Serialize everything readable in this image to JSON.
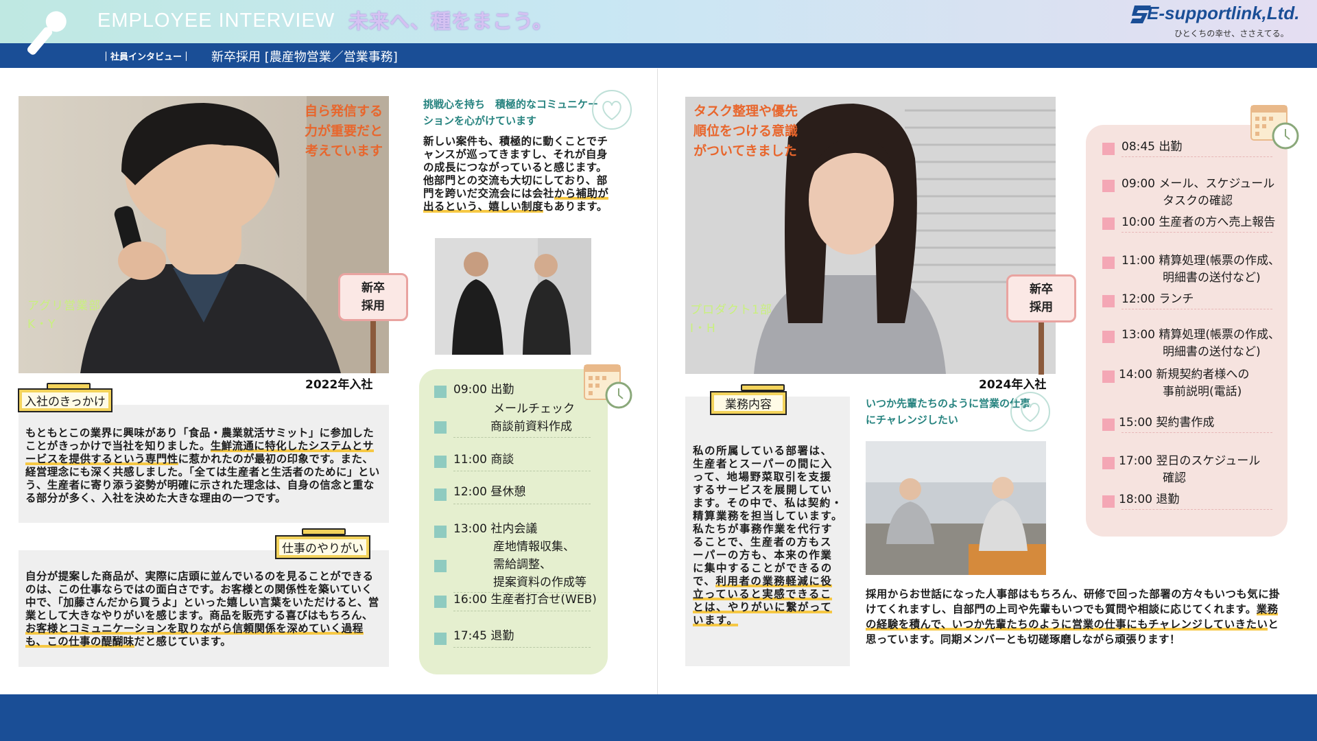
{
  "header": {
    "title": "EMPLOYEE INTERVIEW",
    "tagline": "未来へ、種をまこう。",
    "company_logo": "E-supportlink,Ltd.",
    "company_slogan": "ひとくちの幸せ、ささえてる。",
    "breadcrumb": "｜社員インタビュー｜",
    "section_name": "新卒採用 [農産物営業／営業事務]",
    "icon": "microphone-icon"
  },
  "left": {
    "quote": [
      "自ら発信する",
      "力が重要だと",
      "考えています"
    ],
    "badge": [
      "新卒",
      "採用"
    ],
    "dept": "アグリ営業部",
    "initials": "K・Y",
    "join_year": "2022年入社",
    "reason_label": "入社のきっかけ",
    "reason_text": {
      "p1": "もともとこの業界に興味があり「食品・農業就活サミット」に参加したことがきっかけで当社を知りました。",
      "hl": "生鮮流通に特化したシステムとサービスを提供するという専門性",
      "p2": "に惹かれたのが最初の印象です。また、経営理念にも深く共感しました。「全ては生産者と生活者のために」という、生産者に寄り添う姿勢が明確に示された理念は、自身の信念と重なる部分が多く、入社を決めた大きな理由の一つです。"
    },
    "worth_label": "仕事のやりがい",
    "worth_text": {
      "p1": "自分が提案した商品が、実際に店頭に並んでいるのを見ることができるのは、この仕事ならではの面白さです。お客様との関係性を築いていく中で、「加藤さんだから買うよ」といった嬉しい言葉をいただけると、営業として大きなやりがいを感じます。商品を販売する喜びはもちろん、",
      "hl": "お客様とコミュニケーションを取りながら信頼関係を深めていく過程も、この仕事の醍醐味",
      "p2": "だと感じています。"
    },
    "challenge_title": "挑戦心を持ち　積極的なコミュニケーションを心がけています",
    "challenge_text": {
      "p1": "新しい案件も、積極的に動くことでチャンスが巡ってきますし、それが自身の成長につながっていると感じます。他部門との交流も大切にしており、部門を跨いだ交流会には会社",
      "hl": "から補助が出るという、嬉しい制度",
      "p2": "もあります。"
    },
    "schedule": [
      {
        "time": "09:00 出勤",
        "lines": [
          "メールチェック",
          "商談前資料作成"
        ]
      },
      {
        "time": "11:00 商談",
        "lines": []
      },
      {
        "time": "12:00 昼休憩",
        "lines": []
      },
      {
        "time": "13:00 社内会議",
        "lines": [
          "産地情報収集、",
          "需給調整、",
          "提案資料の作成等"
        ]
      },
      {
        "time": "16:00 生産者打合せ(WEB)",
        "lines": []
      },
      {
        "time": "17:45 退勤",
        "lines": []
      }
    ]
  },
  "right": {
    "quote": [
      "タスク整理や優先",
      "順位をつける意識",
      "がついてきました"
    ],
    "badge": [
      "新卒",
      "採用"
    ],
    "dept": "プロダクト1部",
    "initials": "I・H",
    "join_year": "2024年入社",
    "work_label": "業務内容",
    "work_text": {
      "p1": "私の所属している部署は、生産者とスーパーの間に入って、地場野菜取引を支援するサービスを展開しています。その中で、私は契約・精算業務を担当しています。私たちが事務作業を代行することで、生産者の方もスーパーの方も、本来の作業に集中することができるので、",
      "hl": "利用者の業務軽減に役立っていると実感できることは、やりがいに繋がっています。"
    },
    "future_title": "いつか先輩たちのように営業の仕事にチャレンジしたい",
    "future_text": {
      "p1": "採用からお世話になった人事部はもちろん、研修で回った部署の方々もいつも気に掛けてくれますし、自部門の上司や先輩もいつでも質問や相談に応じてくれます。",
      "hl": "業務の経験を積んで、いつか先輩たちのように営業の仕事にもチャレンジしていきたい",
      "p2": "と思っています。同期メンバーとも切磋琢磨しながら頑張ります！"
    },
    "schedule": [
      {
        "time": "08:45 出勤",
        "lines": []
      },
      {
        "time": "09:00 メール、スケジュール",
        "lines": [
          "タスクの確認"
        ]
      },
      {
        "time": "10:00 生産者の方へ売上報告",
        "lines": []
      },
      {
        "time": "11:00 精算処理(帳票の作成、",
        "lines": [
          "明細書の送付など)"
        ]
      },
      {
        "time": "12:00 ランチ",
        "lines": []
      },
      {
        "time": "13:00 精算処理(帳票の作成、",
        "lines": [
          "明細書の送付など)"
        ]
      },
      {
        "time": "14:00 新規契約者様への",
        "lines": [
          "事前説明(電話)"
        ]
      },
      {
        "time": "15:00 契約書作成",
        "lines": []
      },
      {
        "time": "17:00 翌日のスケジュール",
        "lines": [
          "確認"
        ]
      },
      {
        "time": "18:00 退勤",
        "lines": []
      }
    ]
  },
  "colors": {
    "navy": "#1a4e96",
    "accent_orange": "#e8662c",
    "teal": "#26837f",
    "highlight": "#f6c844",
    "schedule_green": "#e5efcf",
    "schedule_pink": "#f6e3df"
  }
}
